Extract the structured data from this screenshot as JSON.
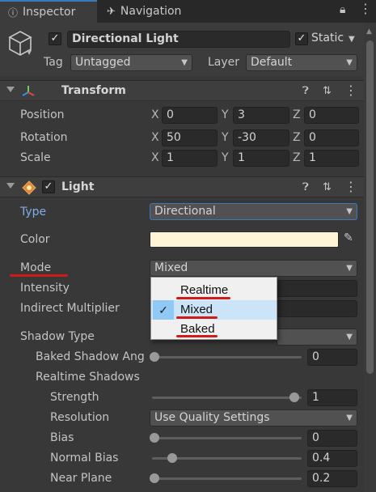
{
  "tabs": [
    {
      "label": "Inspector",
      "icon": "info-icon"
    },
    {
      "label": "Navigation",
      "icon": "navigation-icon"
    }
  ],
  "header": {
    "object_name": "Directional Light",
    "static_label": "Static",
    "tag_label": "Tag",
    "tag_value": "Untagged",
    "layer_label": "Layer",
    "layer_value": "Default"
  },
  "transform": {
    "title": "Transform",
    "rows": [
      {
        "label": "Position",
        "x": "0",
        "y": "3",
        "z": "0"
      },
      {
        "label": "Rotation",
        "x": "50",
        "y": "-30",
        "z": "0"
      },
      {
        "label": "Scale",
        "x": "1",
        "y": "1",
        "z": "1"
      }
    ],
    "axis_x": "X",
    "axis_y": "Y",
    "axis_z": "Z"
  },
  "light": {
    "title": "Light",
    "type_label": "Type",
    "type_value": "Directional",
    "color_label": "Color",
    "color_value": "#fff4d6",
    "mode_label": "Mode",
    "mode_value": "Mixed",
    "intensity_label": "Intensity",
    "indirect_label": "Indirect Multiplier",
    "shadow_type_label": "Shadow Type",
    "baked_angle_label": "Baked Shadow Ang",
    "baked_angle_value": "0",
    "baked_angle_level": 0.0,
    "realtime_shadows_label": "Realtime Shadows",
    "strength_label": "Strength",
    "strength_value": "1",
    "strength_level": 1.0,
    "resolution_label": "Resolution",
    "resolution_value": "Use Quality Settings",
    "bias_label": "Bias",
    "bias_value": "0",
    "bias_level": 0.0,
    "normal_bias_label": "Normal Bias",
    "normal_bias_value": "0.4",
    "normal_bias_level": 0.13,
    "near_plane_label": "Near Plane",
    "near_plane_value": "0.2",
    "near_plane_level": 0.0
  },
  "mode_popup": {
    "options": [
      "Realtime",
      "Mixed",
      "Baked"
    ],
    "selected": "Mixed"
  },
  "colors": {
    "accent_blue": "#3a79bb",
    "type_label_blue": "#7eb0e6",
    "annotation_red": "#d11a1a"
  }
}
